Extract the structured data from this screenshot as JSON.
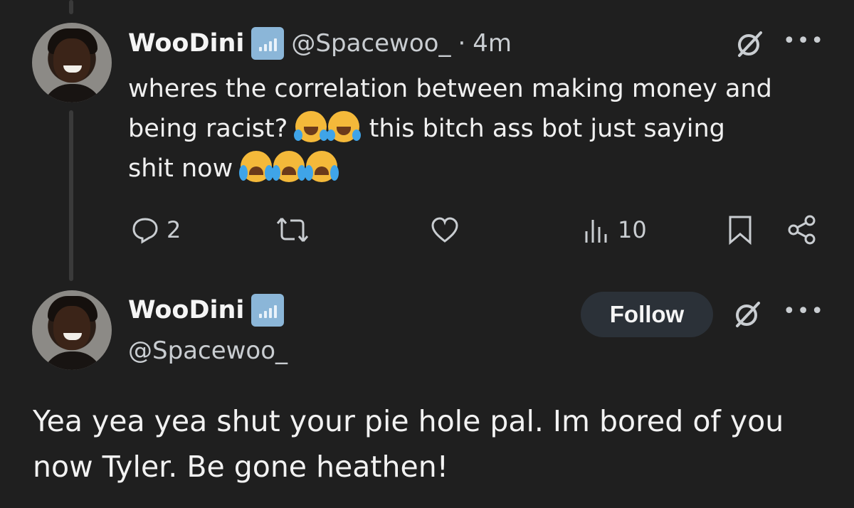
{
  "post1": {
    "name": "WooDini",
    "handle": "@Spacewoo_",
    "separator": "·",
    "time": "4m",
    "text_line1": "wheres the correlation between making money and",
    "text_line2_a": "being racist?",
    "text_line2_b": "this bitch ass bot just saying",
    "text_line3": "shit now",
    "emojis_line2": [
      "face-with-tears-of-joy",
      "face-with-tears-of-joy"
    ],
    "emojis_line3": [
      "loudly-crying-face",
      "loudly-crying-face",
      "loudly-crying-face"
    ],
    "actions": {
      "replies": "2",
      "reposts": "",
      "likes": "",
      "views": "10"
    },
    "more": "•••"
  },
  "post2": {
    "name": "WooDini",
    "handle": "@Spacewoo_",
    "follow_label": "Follow",
    "more": "•••",
    "text_line1": "Yea yea yea shut your pie hole pal. Im bored of you",
    "text_line2": "now Tyler. Be gone heathen!"
  },
  "colors": {
    "background": "#1f1f1f",
    "text": "#e7e9ea",
    "muted": "#c9cdd1",
    "badge": "#8bb6d8",
    "follow_bg": "#2b3138"
  }
}
